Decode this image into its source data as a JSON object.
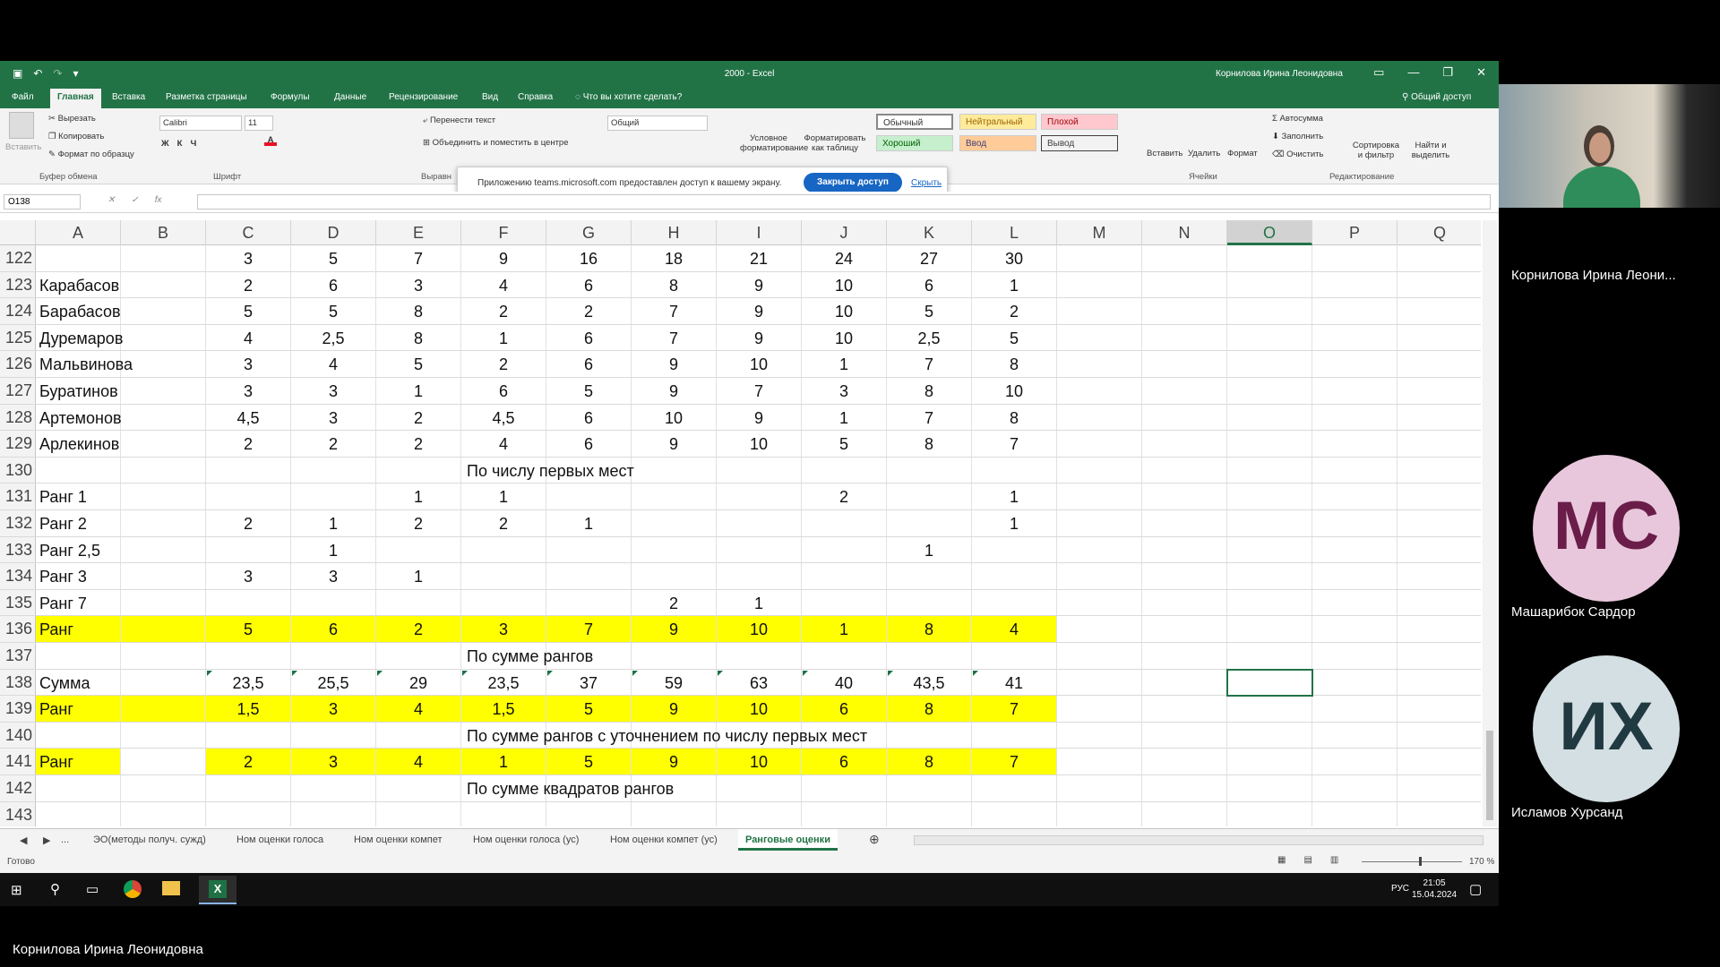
{
  "window": {
    "title": "2000  -  Excel",
    "user": "Корнилова Ирина Леонидовна",
    "minimize": "—",
    "restore": "❐",
    "close": "✕"
  },
  "menu": {
    "tabs": [
      "Файл",
      "Главная",
      "Вставка",
      "Разметка страницы",
      "Формулы",
      "Данные",
      "Рецензирование",
      "Вид",
      "Справка"
    ],
    "tell_me": "Что вы хотите сделать?",
    "share": "Общий доступ"
  },
  "ribbon": {
    "paste": "Вставить",
    "cut": "Вырезать",
    "copy": "Копировать",
    "format_painter": "Формат по образцу",
    "clipboard_label": "Буфер обмена",
    "font_name": "Calibri",
    "font_size": "11",
    "font_label": "Шрифт",
    "wrap_text": "Перенести текст",
    "merge_center": "Объединить и поместить в центре",
    "align_label": "Выравн",
    "number_format": "Общий",
    "conditional": "Условное форматирование",
    "format_table": "Форматировать как таблицу",
    "styles": {
      "normal": "Обычный",
      "neutral": "Нейтральный",
      "bad": "Плохой",
      "good": "Хороший",
      "input": "Ввод",
      "output": "Вывод"
    },
    "insert": "Вставить",
    "delete": "Удалить",
    "format": "Формат",
    "cells_label": "Ячейки",
    "autosum": "Автосумма",
    "fill": "Заполнить",
    "clear": "Очистить",
    "sort_filter": "Сортировка и фильтр",
    "find_select": "Найти и выделить",
    "editing_label": "Редактирование"
  },
  "notification": {
    "message": "Приложению teams.microsoft.com предоставлен доступ к вашему экрану.",
    "stop_button": "Закрыть доступ",
    "hide_link": "Скрыть"
  },
  "formula_bar": {
    "name_box": "O138",
    "fx": "fx",
    "formula": ""
  },
  "columns": [
    "A",
    "B",
    "C",
    "D",
    "E",
    "F",
    "G",
    "H",
    "I",
    "J",
    "K",
    "L",
    "M",
    "N",
    "O",
    "P",
    "Q"
  ],
  "selected_column": "O",
  "selected_cell": "O138",
  "rows": [
    {
      "num": "122",
      "label": "",
      "vals": [
        "3",
        "5",
        "7",
        "9",
        "16",
        "18",
        "21",
        "24",
        "27",
        "30"
      ]
    },
    {
      "num": "123",
      "label": "Карабасов",
      "vals": [
        "2",
        "6",
        "3",
        "4",
        "6",
        "8",
        "9",
        "10",
        "6",
        "1"
      ]
    },
    {
      "num": "124",
      "label": "Барабасов",
      "vals": [
        "5",
        "5",
        "8",
        "2",
        "2",
        "7",
        "9",
        "10",
        "5",
        "2"
      ]
    },
    {
      "num": "125",
      "label": "Дуремаров",
      "vals": [
        "4",
        "2,5",
        "8",
        "1",
        "6",
        "7",
        "9",
        "10",
        "2,5",
        "5"
      ]
    },
    {
      "num": "126",
      "label": "Мальвинова",
      "vals": [
        "3",
        "4",
        "5",
        "2",
        "6",
        "9",
        "10",
        "1",
        "7",
        "8"
      ]
    },
    {
      "num": "127",
      "label": "Буратинов",
      "vals": [
        "3",
        "3",
        "1",
        "6",
        "5",
        "9",
        "7",
        "3",
        "8",
        "10"
      ]
    },
    {
      "num": "128",
      "label": "Артемонов",
      "vals": [
        "4,5",
        "3",
        "2",
        "4,5",
        "6",
        "10",
        "9",
        "1",
        "7",
        "8"
      ]
    },
    {
      "num": "129",
      "label": "Арлекинов",
      "vals": [
        "2",
        "2",
        "2",
        "4",
        "6",
        "9",
        "10",
        "5",
        "8",
        "7"
      ]
    },
    {
      "num": "130",
      "label": "",
      "vals": [
        "",
        "",
        "",
        "",
        "",
        "",
        "",
        "",
        "",
        ""
      ],
      "note": "По числу первых мест"
    },
    {
      "num": "131",
      "label": "Ранг 1",
      "vals": [
        "",
        "",
        "1",
        "1",
        "",
        "",
        "",
        "2",
        "",
        "1"
      ]
    },
    {
      "num": "132",
      "label": "Ранг 2",
      "vals": [
        "2",
        "1",
        "2",
        "2",
        "1",
        "",
        "",
        "",
        "",
        "1"
      ]
    },
    {
      "num": "133",
      "label": "Ранг 2,5",
      "vals": [
        "",
        "1",
        "",
        "",
        "",
        "",
        "",
        "",
        "1",
        ""
      ]
    },
    {
      "num": "134",
      "label": "Ранг 3",
      "vals": [
        "3",
        "3",
        "1",
        "",
        "",
        "",
        "",
        "",
        "",
        ""
      ]
    },
    {
      "num": "135",
      "label": "Ранг 7",
      "vals": [
        "",
        "",
        "",
        "",
        "",
        "2",
        "1",
        "",
        "",
        ""
      ]
    },
    {
      "num": "136",
      "label": "Ранг",
      "vals": [
        "5",
        "6",
        "2",
        "3",
        "7",
        "9",
        "10",
        "1",
        "8",
        "4"
      ],
      "highlight": "full"
    },
    {
      "num": "137",
      "label": "",
      "vals": [
        "",
        "",
        "",
        "",
        "",
        "",
        "",
        "",
        "",
        ""
      ],
      "note": "По сумме рангов"
    },
    {
      "num": "138",
      "label": "Сумма",
      "vals": [
        "23,5",
        "25,5",
        "29",
        "23,5",
        "37",
        "59",
        "63",
        "40",
        "43,5",
        "41"
      ],
      "flag": true
    },
    {
      "num": "139",
      "label": "Ранг",
      "vals": [
        "1,5",
        "3",
        "4",
        "1,5",
        "5",
        "9",
        "10",
        "6",
        "8",
        "7"
      ],
      "highlight": "full"
    },
    {
      "num": "140",
      "label": "",
      "vals": [
        "",
        "",
        "",
        "",
        "",
        "",
        "",
        "",
        "",
        ""
      ],
      "note": "По сумме рангов с уточнением по числу первых мест"
    },
    {
      "num": "141",
      "label": "Ранг",
      "vals": [
        "2",
        "3",
        "4",
        "1",
        "5",
        "9",
        "10",
        "6",
        "8",
        "7"
      ],
      "highlight": "partial"
    },
    {
      "num": "142",
      "label": "",
      "vals": [
        "",
        "",
        "",
        "",
        "",
        "",
        "",
        "",
        "",
        ""
      ],
      "note": "По сумме квадратов рангов"
    },
    {
      "num": "143",
      "label": "",
      "vals": [
        "",
        "",
        "",
        "",
        "",
        "",
        "",
        "",
        "",
        ""
      ]
    }
  ],
  "sheet_tabs": [
    "ЭО(методы получ. сужд)",
    "Ном оценки голоса",
    "Ном оценки компет",
    "Ном оценки голоса (ус)",
    "Ном оценки компет (ус)",
    "Ранговые оценки"
  ],
  "active_sheet": "Ранговые оценки",
  "sheet_tabs_more": "...",
  "status": {
    "ready": "Готово",
    "zoom": "170 %"
  },
  "taskbar": {
    "lang": "РУС",
    "time": "21:05",
    "date": "15.04.2024"
  },
  "participants": [
    {
      "name": "Корнилова Ирина Леони...",
      "initials": ""
    },
    {
      "name": "Машарибок Сардор",
      "initials": "МС",
      "color": "#e8c7dc",
      "text_color": "#6b1d4a"
    },
    {
      "name": "Исламов Хурсанд",
      "initials": "ИХ",
      "color": "#d4dfe3",
      "text_color": "#213a42"
    }
  ],
  "presenter_name": "Корнилова Ирина Леонидовна"
}
